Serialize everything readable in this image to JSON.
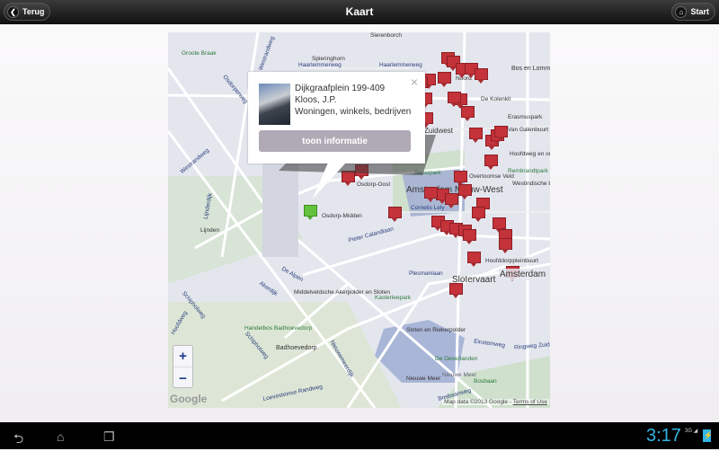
{
  "header": {
    "title": "Kaart",
    "back_label": "Terug",
    "start_label": "Start",
    "back_icon": "chevron-left-icon",
    "start_icon": "home-icon"
  },
  "popup": {
    "address": "Dijkgraafplein 199-409",
    "architect": "Kloos, J.P.",
    "function": "Woningen, winkels, bedrijven",
    "button_label": "toon informatie",
    "close_symbol": "×"
  },
  "map": {
    "zoom_in": "+",
    "zoom_out": "−",
    "logo": "Google",
    "attribution": "Map data ©2013 Google",
    "terms": "Terms of Use",
    "labels": {
      "sierenborch": "Sierenborch",
      "spieringhorn": "Spieringhorn",
      "haarlemmerweg": "Haarlemmerweg",
      "haarlemmerweg2": "Haarlemmerweg",
      "westrandweg": "Westrandweg",
      "westrandweg2": "Westrandweg",
      "groote_braak": "Groote Braak",
      "osdorperweg": "Osdorperweg",
      "lijnden": "Lijnden",
      "lijnderdijk": "Lijnderdijk",
      "bos_en_lommer": "Bos en Lommer",
      "de_kolenkit": "De Kolenkit",
      "erasmuspark": "Erasmuspark",
      "van_galenbuurt": "Van Galenbuurt",
      "zuidwest": "Zuidwest",
      "hoofdweg": "Hoofdweg en omgeving",
      "rembrandtpark": "Rembrandtpark",
      "overtoomse_veld": "Overtoomse Veld",
      "westindische": "Westindische buurt",
      "sloterpark": "Sloterpark",
      "osdorp_oost": "Osdorp-Oost",
      "osdorp_midden": "Osdorp-Midden",
      "amsterdam_nieuw": "Amsterdam Nieuw-West",
      "cornelis": "Cornelis Lely",
      "pieter_calandlaan": "Pieter Calandlaan",
      "plesmanlaan": "Plesmanlaan",
      "slotervaart": "Slotervaart",
      "de_alpen": "De Alpen",
      "akerdijk": "Akerdijk",
      "middelveldsche": "Middelveldsche Akerpolder en Sloten",
      "kasterleepark": "Kasterleepark",
      "schipholweg": "Schipholweg",
      "schipholweg2": "Schipholweg",
      "hoofdweg2": "Hoofdweg",
      "handelbos": "Handelbos Badhoevedorp",
      "badhoevedorp": "Badhoevedorp",
      "nieuwemeerdijk": "Nieuwemeerdijk",
      "sloten_riekerpolder": "Sloten en Riekerpolder",
      "einsteinweg": "Einsteinweg",
      "ringweg_zuid": "Ringweg Zuid",
      "de_oeverlanden": "De Oeverlanden",
      "nieuwe_meer": "Nieuwe Meer",
      "nieuwe_meer2": "Nieuwe Meer",
      "bosbaanweg": "Bosbaanweg",
      "bosbaan": "Bosbaan",
      "loevesteinse": "Loevesteinse Randweg",
      "amsterdam": "Amsterdam",
      "hoofddorpplein": "Hoofddorppleinbuurt",
      "noord": "Noord"
    }
  },
  "statusbar": {
    "time": "3:17",
    "network": "3G",
    "nav_back_icon": "back-icon",
    "nav_home_icon": "home-icon",
    "nav_recents_icon": "recents-icon",
    "battery_icon": "battery-charging-icon",
    "signal_icon": "signal-icon"
  }
}
